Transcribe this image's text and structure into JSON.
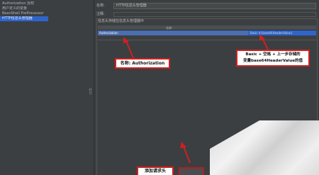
{
  "tree": {
    "items": [
      {
        "label": "Authorization 授权"
      },
      {
        "label": "用户定义的变量"
      },
      {
        "label": "BeanShell PreProcessor"
      },
      {
        "label": "HTTP信息头管理器",
        "selected": true
      }
    ]
  },
  "form": {
    "name_label": "名称:",
    "name_value": "HTTP信息头管理器",
    "comment_label": "注释:",
    "group_title": "信息头存储在信息头管理器中",
    "table": {
      "columns": [
        "名称:",
        "值"
      ],
      "rows": [
        {
          "name": "Authorization",
          "value": "Basic ${base64HeaderValue}"
        }
      ]
    }
  },
  "annotations": {
    "name_callout": "名称: Authorization",
    "value_callout_line1": "Basic + 空格 + 上一步存储的",
    "value_callout_line2": "变量base64HeaderValue的值",
    "add_callout": "添加请求头"
  },
  "colors": {
    "background": "#3c3f41",
    "selection": "#2f65ca",
    "annotation_red": "#d02020"
  }
}
